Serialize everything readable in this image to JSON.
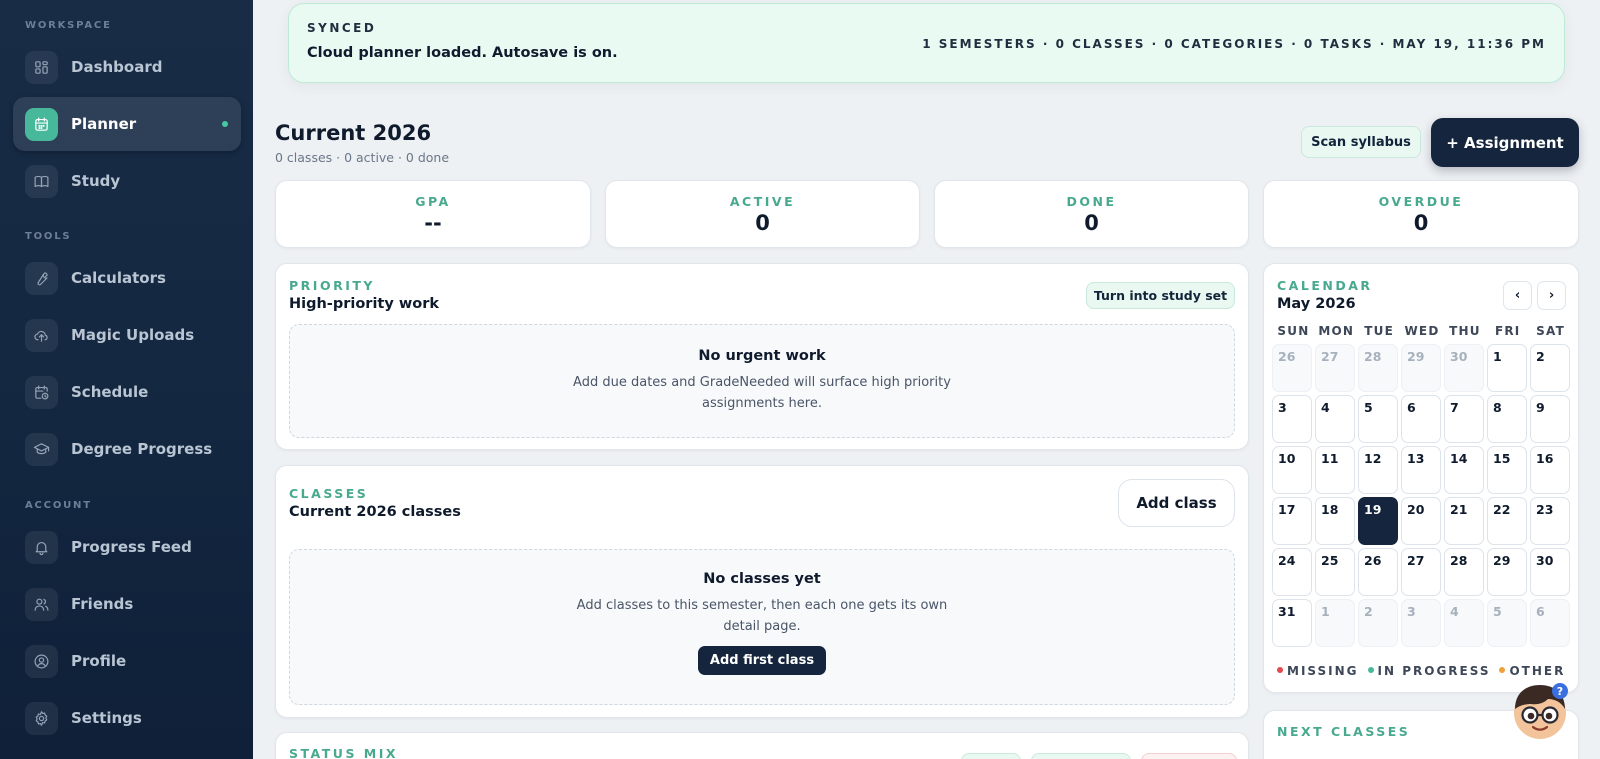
{
  "sidebar": {
    "sections": {
      "workspace": "WORKSPACE",
      "tools": "TOOLS",
      "account": "ACCOUNT"
    },
    "items": [
      {
        "label": "Dashboard",
        "icon": "grid-icon"
      },
      {
        "label": "Planner",
        "icon": "calendar-icon"
      },
      {
        "label": "Study",
        "icon": "book-icon"
      },
      {
        "label": "Calculators",
        "icon": "wrench-icon"
      },
      {
        "label": "Magic Uploads",
        "icon": "cloud-upload-icon"
      },
      {
        "label": "Schedule",
        "icon": "calendar-clock-icon"
      },
      {
        "label": "Degree Progress",
        "icon": "graduation-cap-icon"
      },
      {
        "label": "Progress Feed",
        "icon": "bell-icon"
      },
      {
        "label": "Friends",
        "icon": "users-icon"
      },
      {
        "label": "Profile",
        "icon": "user-circle-icon"
      },
      {
        "label": "Settings",
        "icon": "gear-icon"
      }
    ],
    "active_item": "Planner"
  },
  "sync": {
    "status": "SYNCED",
    "message": "Cloud planner loaded. Autosave is on.",
    "stats": "1 SEMESTERS · 0 CLASSES · 0 CATEGORIES · 0 TASKS · MAY 19, 11:36 PM"
  },
  "header": {
    "title": "Current 2026",
    "subtitle": "0 classes · 0 active · 0 done",
    "scan_label": "Scan syllabus",
    "assignment_label": "+ Assignment"
  },
  "stats": [
    {
      "label": "GPA",
      "value": "--"
    },
    {
      "label": "ACTIVE",
      "value": "0"
    },
    {
      "label": "DONE",
      "value": "0"
    },
    {
      "label": "OVERDUE",
      "value": "0"
    }
  ],
  "priority": {
    "eyebrow": "PRIORITY",
    "title": "High-priority work",
    "button": "Turn into study set",
    "empty_title": "No urgent work",
    "empty_desc": "Add due dates and GradeNeeded will surface high priority assignments here."
  },
  "classes": {
    "eyebrow": "CLASSES",
    "title": "Current 2026 classes",
    "add_button": "Add class",
    "empty_title": "No classes yet",
    "empty_desc": "Add classes to this semester, then each one gets its own detail page.",
    "first_button": "Add first class"
  },
  "status_mix": {
    "eyebrow": "STATUS MIX"
  },
  "calendar": {
    "eyebrow": "CALENDAR",
    "month": "May 2026",
    "prev": "‹",
    "next": "›",
    "weekdays": [
      "SUN",
      "MON",
      "TUE",
      "WED",
      "THU",
      "FRI",
      "SAT"
    ],
    "days": [
      {
        "d": "26",
        "outside": true
      },
      {
        "d": "27",
        "outside": true
      },
      {
        "d": "28",
        "outside": true
      },
      {
        "d": "29",
        "outside": true
      },
      {
        "d": "30",
        "outside": true
      },
      {
        "d": "1"
      },
      {
        "d": "2"
      },
      {
        "d": "3"
      },
      {
        "d": "4"
      },
      {
        "d": "5"
      },
      {
        "d": "6"
      },
      {
        "d": "7"
      },
      {
        "d": "8"
      },
      {
        "d": "9"
      },
      {
        "d": "10"
      },
      {
        "d": "11"
      },
      {
        "d": "12"
      },
      {
        "d": "13"
      },
      {
        "d": "14"
      },
      {
        "d": "15"
      },
      {
        "d": "16"
      },
      {
        "d": "17"
      },
      {
        "d": "18"
      },
      {
        "d": "19",
        "today": true
      },
      {
        "d": "20"
      },
      {
        "d": "21"
      },
      {
        "d": "22"
      },
      {
        "d": "23"
      },
      {
        "d": "24"
      },
      {
        "d": "25"
      },
      {
        "d": "26"
      },
      {
        "d": "27"
      },
      {
        "d": "28"
      },
      {
        "d": "29"
      },
      {
        "d": "30"
      },
      {
        "d": "31"
      },
      {
        "d": "1",
        "outside": true
      },
      {
        "d": "2",
        "outside": true
      },
      {
        "d": "3",
        "outside": true
      },
      {
        "d": "4",
        "outside": true
      },
      {
        "d": "5",
        "outside": true
      },
      {
        "d": "6",
        "outside": true
      }
    ],
    "legend": [
      {
        "label": "MISSING",
        "color": "#e5484d"
      },
      {
        "label": "IN PROGRESS",
        "color": "#48b89b"
      },
      {
        "label": "OTHER",
        "color": "#f0a03c"
      }
    ]
  },
  "next_classes": {
    "eyebrow": "NEXT CLASSES"
  },
  "colors": {
    "accent": "#48a98e",
    "navy": "#14253d",
    "sidebar_bg": "#132740"
  }
}
